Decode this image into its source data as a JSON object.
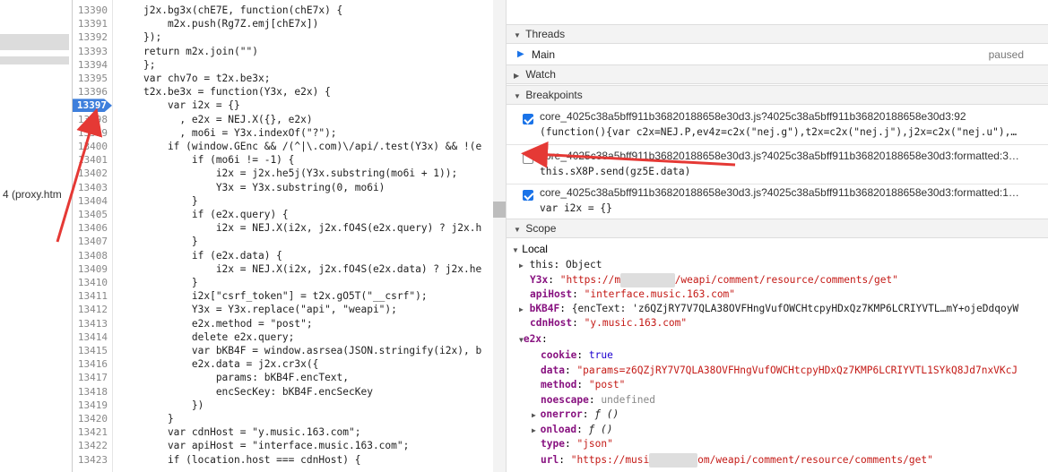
{
  "left_pane": {
    "file_label": "4 (proxy.htm"
  },
  "editor": {
    "lines": [
      {
        "n": "13390",
        "code": "j2x.bg3x(chE7E, function(chE7x) {"
      },
      {
        "n": "13391",
        "code": "    m2x.push(Rg7Z.emj[chE7x])"
      },
      {
        "n": "13392",
        "code": "});"
      },
      {
        "n": "13393",
        "code": "return m2x.join(\"\")"
      },
      {
        "n": "13394",
        "code": "};"
      },
      {
        "n": "13395",
        "code": "var chv7o = t2x.be3x;"
      },
      {
        "n": "13396",
        "code": "t2x.be3x = function(Y3x, e2x) {"
      },
      {
        "n": "13397",
        "code": "    var i2x = {}"
      },
      {
        "n": "13398",
        "code": "      , e2x = NEJ.X({}, e2x)"
      },
      {
        "n": "13399",
        "code": "      , mo6i = Y3x.indexOf(\"?\");"
      },
      {
        "n": "13400",
        "code": "    if (window.GEnc && /(^|\\.com)\\/api/.test(Y3x) && !(e"
      },
      {
        "n": "13401",
        "code": "        if (mo6i != -1) {"
      },
      {
        "n": "13402",
        "code": "            i2x = j2x.he5j(Y3x.substring(mo6i + 1));"
      },
      {
        "n": "13403",
        "code": "            Y3x = Y3x.substring(0, mo6i)"
      },
      {
        "n": "13404",
        "code": "        }"
      },
      {
        "n": "13405",
        "code": "        if (e2x.query) {"
      },
      {
        "n": "13406",
        "code": "            i2x = NEJ.X(i2x, j2x.fO4S(e2x.query) ? j2x.h"
      },
      {
        "n": "13407",
        "code": "        }"
      },
      {
        "n": "13408",
        "code": "        if (e2x.data) {"
      },
      {
        "n": "13409",
        "code": "            i2x = NEJ.X(i2x, j2x.fO4S(e2x.data) ? j2x.he"
      },
      {
        "n": "13410",
        "code": "        }"
      },
      {
        "n": "13411",
        "code": "        i2x[\"csrf_token\"] = t2x.gO5T(\"__csrf\");"
      },
      {
        "n": "13412",
        "code": "        Y3x = Y3x.replace(\"api\", \"weapi\");"
      },
      {
        "n": "13413",
        "code": "        e2x.method = \"post\";"
      },
      {
        "n": "13414",
        "code": "        delete e2x.query;"
      },
      {
        "n": "13415",
        "code": "        var bKB4F = window.asrsea(JSON.stringify(i2x), b"
      },
      {
        "n": "13416",
        "code": "        e2x.data = j2x.cr3x({"
      },
      {
        "n": "13417",
        "code": "            params: bKB4F.encText,"
      },
      {
        "n": "13418",
        "code": "            encSecKey: bKB4F.encSecKey"
      },
      {
        "n": "13419",
        "code": "        })"
      },
      {
        "n": "13420",
        "code": "    }"
      },
      {
        "n": "13421",
        "code": "    var cdnHost = \"y.music.163.com\";"
      },
      {
        "n": "13422",
        "code": "    var apiHost = \"interface.music.163.com\";"
      },
      {
        "n": "13423",
        "code": "    if (location.host === cdnHost) {"
      }
    ],
    "active_line": "13397"
  },
  "threads": {
    "header": "Threads",
    "main_label": "Main",
    "main_status": "paused"
  },
  "watch": {
    "header": "Watch"
  },
  "breakpoints": {
    "header": "Breakpoints",
    "items": [
      {
        "checked": true,
        "location": "core_4025c38a5bff911b36820188658e30d3.js?4025c38a5bff911b36820188658e30d3:92",
        "snippet": "(function(){var c2x=NEJ.P,ev4z=c2x(\"nej.g\"),t2x=c2x(\"nej.j\"),j2x=c2x(\"nej.u\"),…"
      },
      {
        "checked": false,
        "location": "core_4025c38a5bff911b36820188658e30d3.js?4025c38a5bff911b36820188658e30d3:formatted:3…",
        "snippet": "this.sX8P.send(gz5E.data)"
      },
      {
        "checked": true,
        "location": "core_4025c38a5bff911b36820188658e30d3.js?4025c38a5bff911b36820188658e30d3:formatted:1…",
        "snippet": "var i2x = {}"
      }
    ]
  },
  "scope": {
    "header": "Scope",
    "local_header": "Local",
    "this_row": {
      "key": "this",
      "value": "Object"
    },
    "y3x": {
      "key": "Y3x",
      "pre": "\"https://m",
      "post": "/weapi/comment/resource/comments/get\""
    },
    "apiHost": {
      "key": "apiHost",
      "value": "\"interface.music.163.com\""
    },
    "bKB4F": {
      "key": "bKB4F",
      "value": "{encText: 'z6QZjRY7V7QLA38OVFHngVufOWCHtcpyHDxQz7KMP6LCRIYVTL…mY+ojeDdqoyW"
    },
    "cdnHost": {
      "key": "cdnHost",
      "value": "\"y.music.163.com\""
    },
    "e2x": {
      "key": "e2x"
    },
    "e2x_props": [
      {
        "key": "cookie",
        "value": "true",
        "cls": "num",
        "arrow": false
      },
      {
        "key": "data",
        "value": "\"params=z6QZjRY7V7QLA38OVFHngVufOWCHtcpyHDxQz7KMP6LCRIYVTL1SYkQ8Jd7nxVKcJ",
        "cls": "str",
        "arrow": false
      },
      {
        "key": "method",
        "value": "\"post\"",
        "cls": "str",
        "arrow": false
      },
      {
        "key": "noescape",
        "value": "undefined",
        "cls": "u",
        "arrow": false
      },
      {
        "key": "onerror",
        "value": "ƒ ()",
        "cls": "fn",
        "arrow": true
      },
      {
        "key": "onload",
        "value": "ƒ ()",
        "cls": "fn",
        "arrow": true
      },
      {
        "key": "type",
        "value": "\"json\"",
        "cls": "str",
        "arrow": false
      }
    ],
    "url": {
      "key": "url",
      "pre": "\"https://musi",
      "post": "om/weapi/comment/resource/comments/get\""
    }
  },
  "colors": {
    "breakpoint": "#3e7fdc",
    "annotation": "#e53935",
    "checkbox": "#1a73e8"
  }
}
